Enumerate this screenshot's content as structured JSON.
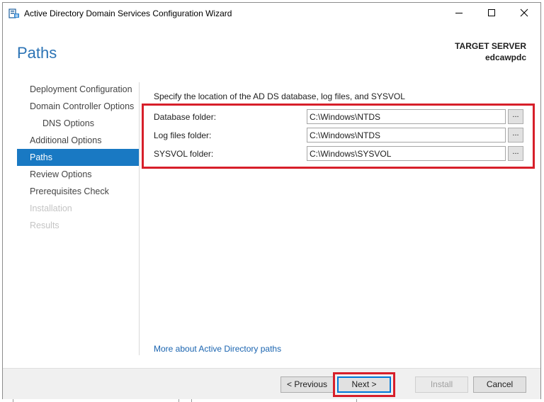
{
  "window": {
    "title": "Active Directory Domain Services Configuration Wizard",
    "controls": {
      "minimize_icon": "minimize-icon",
      "maximize_icon": "maximize-icon",
      "close_icon": "close-icon"
    }
  },
  "page": {
    "title": "Paths",
    "target_server_label": "TARGET SERVER",
    "target_server_name": "edcawpdc"
  },
  "nav": {
    "items": [
      {
        "label": "Deployment Configuration",
        "state": "normal"
      },
      {
        "label": "Domain Controller Options",
        "state": "normal"
      },
      {
        "label": "DNS Options",
        "state": "sub"
      },
      {
        "label": "Additional Options",
        "state": "normal"
      },
      {
        "label": "Paths",
        "state": "active"
      },
      {
        "label": "Review Options",
        "state": "normal"
      },
      {
        "label": "Prerequisites Check",
        "state": "normal"
      },
      {
        "label": "Installation",
        "state": "disabled"
      },
      {
        "label": "Results",
        "state": "disabled"
      }
    ]
  },
  "main": {
    "intro": "Specify the location of the AD DS database, log files, and SYSVOL",
    "fields": [
      {
        "label": "Database folder:",
        "value": "C:\\Windows\\NTDS",
        "browse": "..."
      },
      {
        "label": "Log files folder:",
        "value": "C:\\Windows\\NTDS",
        "browse": "..."
      },
      {
        "label": "SYSVOL folder:",
        "value": "C:\\Windows\\SYSVOL",
        "browse": "..."
      }
    ],
    "more_link": "More about Active Directory paths"
  },
  "footer": {
    "previous": "< Previous",
    "next": "Next >",
    "install": "Install",
    "cancel": "Cancel"
  },
  "colors": {
    "accent": "#1979c3",
    "title": "#2b73b5",
    "highlight": "#d71f2a",
    "link": "#1a64b0"
  }
}
